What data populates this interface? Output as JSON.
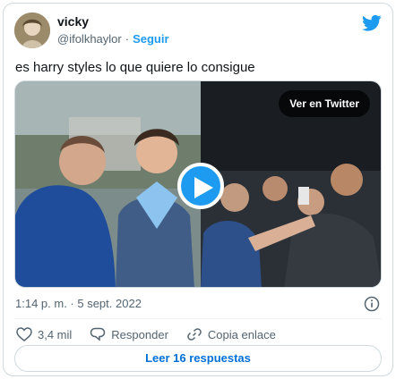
{
  "author": {
    "name": "vicky",
    "handle": "@ifolkhaylor",
    "separator": "·",
    "follow_label": "Seguir"
  },
  "tweet": {
    "text": "es harry styles lo que quiere lo consigue"
  },
  "media": {
    "view_on_twitter_label": "Ver en Twitter",
    "play_icon": "play-icon"
  },
  "timestamp": "1:14 p. m. · 5 sept. 2022",
  "actions": {
    "like_count": "3,4 mil",
    "reply_label": "Responder",
    "copy_link_label": "Copia enlace"
  },
  "read_replies_label": "Leer 16 respuestas",
  "colors": {
    "accent": "#1d9bf0",
    "link": "#006fd6",
    "muted": "#536471",
    "border": "#cfd9de"
  },
  "icons": [
    "twitter-logo-icon",
    "play-icon",
    "info-icon",
    "heart-icon",
    "reply-icon",
    "link-icon"
  ]
}
